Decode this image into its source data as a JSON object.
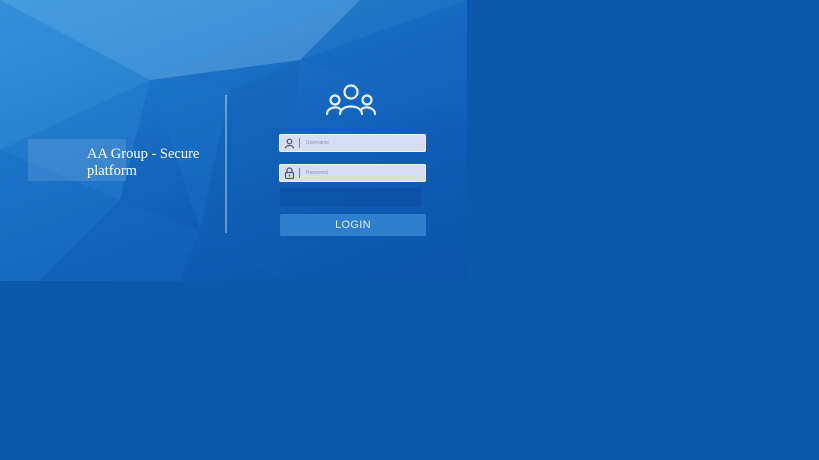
{
  "brand": {
    "title": "AA Group - Secure platform"
  },
  "form": {
    "username_placeholder": "Username",
    "password_placeholder": "Password",
    "login_label": "LOGIN"
  },
  "icons": {
    "header": "users-icon",
    "username": "user-icon",
    "password": "lock-icon"
  },
  "colors": {
    "page_background": "#0c58ab",
    "button": "#2f7fcf",
    "field": "#d6def0"
  }
}
